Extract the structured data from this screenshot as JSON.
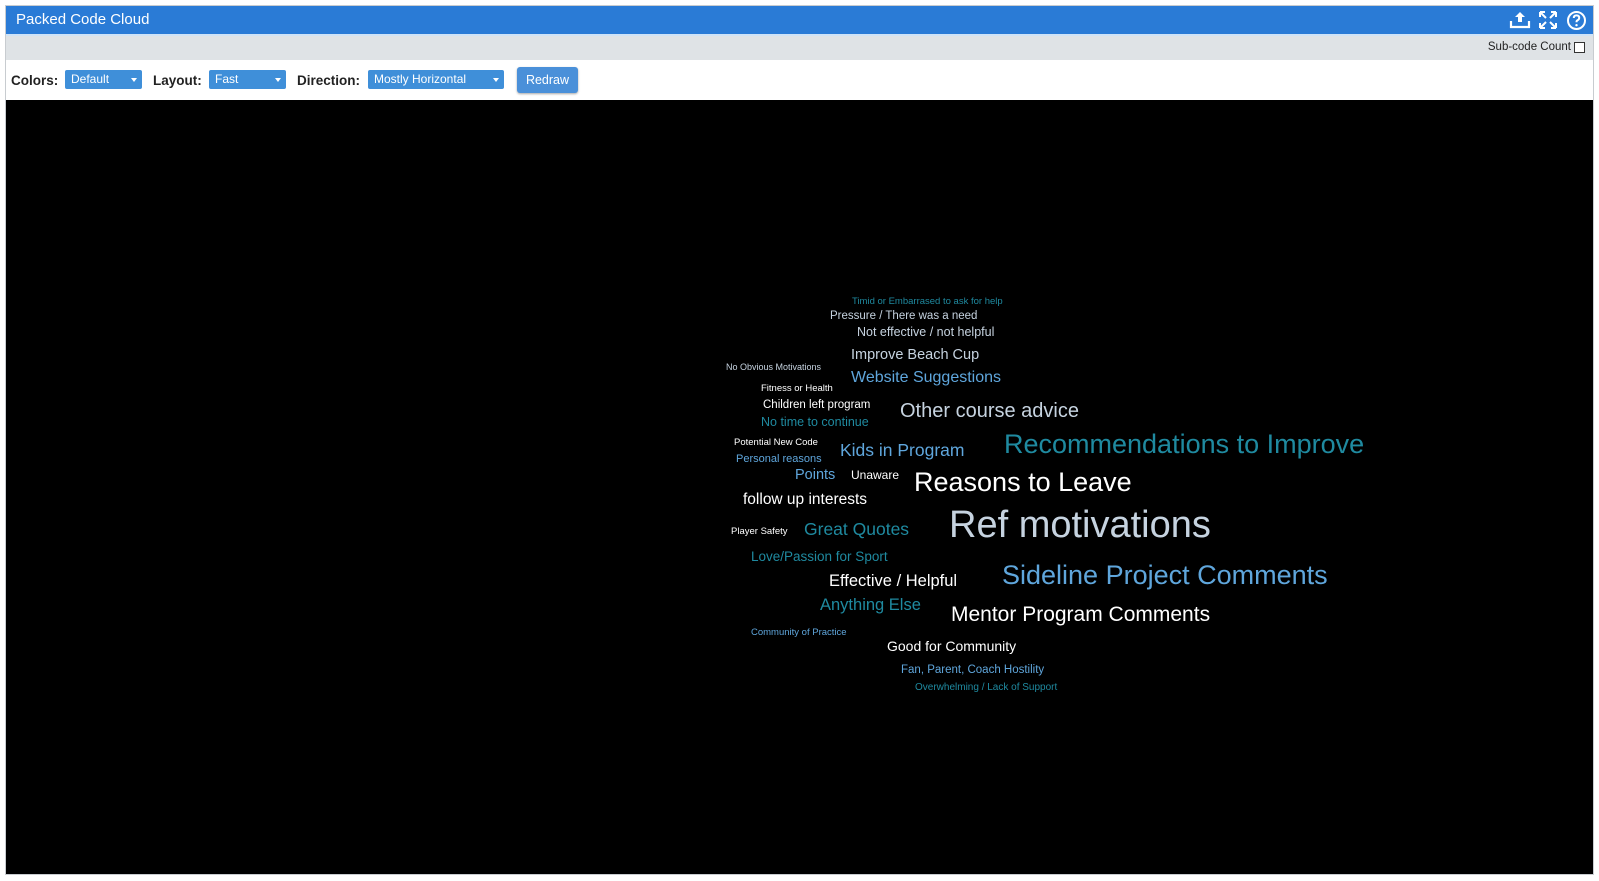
{
  "window": {
    "title": "Packed Code Cloud",
    "icons": [
      "export-icon",
      "fullscreen-icon",
      "help-icon"
    ]
  },
  "subbar": {
    "subcode_count_label": "Sub-code Count",
    "subcode_count_checked": false
  },
  "toolbar": {
    "colors_label": "Colors:",
    "colors_value": "Default",
    "layout_label": "Layout:",
    "layout_value": "Fast",
    "direction_label": "Direction:",
    "direction_value": "Mostly Horizontal",
    "redraw_label": "Redraw"
  },
  "palette": {
    "white": "#ffffff",
    "light": "#c6d3e0",
    "blue": "#5fa6dc",
    "teal": "#1f8aa0",
    "background": "#000000",
    "accent": "#2a7bd6"
  },
  "cloud": {
    "words": [
      {
        "text": "Timid or Embarrased to ask for help",
        "color": "teal"
      },
      {
        "text": "Pressure / There was a need",
        "color": "light"
      },
      {
        "text": "Not effective / not helpful",
        "color": "light"
      },
      {
        "text": "No Obvious Motivations",
        "color": "light"
      },
      {
        "text": "Improve Beach Cup",
        "color": "light"
      },
      {
        "text": "Fitness or Health",
        "color": "white"
      },
      {
        "text": "Website Suggestions",
        "color": "blue"
      },
      {
        "text": "Children left program",
        "color": "white"
      },
      {
        "text": "Other course advice",
        "color": "light"
      },
      {
        "text": "No time to continue",
        "color": "teal"
      },
      {
        "text": "Potential New Code",
        "color": "white"
      },
      {
        "text": "Kids in Program",
        "color": "blue"
      },
      {
        "text": "Recommendations to Improve",
        "color": "teal"
      },
      {
        "text": "Personal reasons",
        "color": "blue"
      },
      {
        "text": "Points",
        "color": "blue"
      },
      {
        "text": "Unaware",
        "color": "white"
      },
      {
        "text": "Reasons to Leave",
        "color": "white"
      },
      {
        "text": "follow up interests",
        "color": "white"
      },
      {
        "text": "Player Safety",
        "color": "white"
      },
      {
        "text": "Great Quotes",
        "color": "teal"
      },
      {
        "text": "Ref motivations",
        "color": "light"
      },
      {
        "text": "Love/Passion for Sport",
        "color": "teal"
      },
      {
        "text": "Effective / Helpful",
        "color": "white"
      },
      {
        "text": "Sideline Project Comments",
        "color": "blue"
      },
      {
        "text": "Anything Else",
        "color": "teal"
      },
      {
        "text": "Mentor Program Comments",
        "color": "white"
      },
      {
        "text": "Community of Practice",
        "color": "blue"
      },
      {
        "text": "Good for Community",
        "color": "white"
      },
      {
        "text": "Fan, Parent, Coach Hostility",
        "color": "blue"
      },
      {
        "text": "Overwhelming / Lack of Support",
        "color": "teal"
      }
    ]
  }
}
